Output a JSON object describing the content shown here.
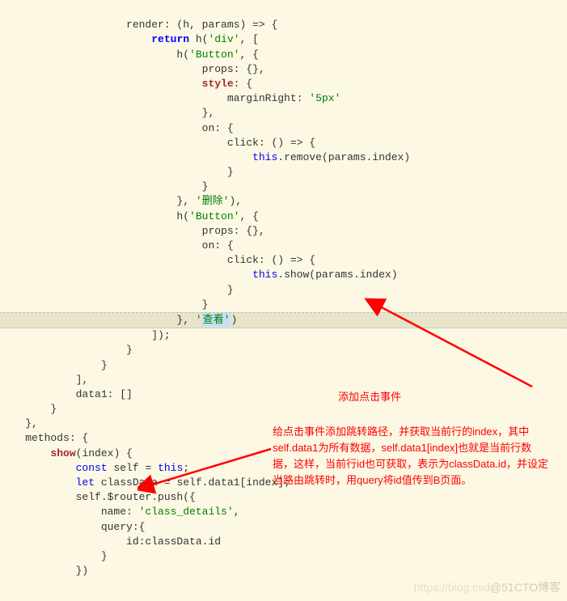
{
  "code": {
    "l1": "                    render: (h, params) => {",
    "l2a": "                        ",
    "l2b": "return",
    "l2c": " h(",
    "l2d": "'div'",
    "l2e": ", [",
    "l3a": "                            h(",
    "l3b": "'Button'",
    "l3c": ", {",
    "l4": "                                props: {},",
    "l5a": "                                ",
    "l5b": "style",
    "l5c": ": {",
    "l6a": "                                    marginRight: ",
    "l6b": "'5px'",
    "l7": "                                },",
    "l8": "                                on: {",
    "l9": "                                    click: () => {",
    "l10a": "                                        ",
    "l10b": "this",
    "l10c": ".remove(params.index)",
    "l11": "                                    }",
    "l12": "                                }",
    "l13a": "                            }, ",
    "l13b": "'删除'",
    "l13c": "),",
    "l14a": "                            h(",
    "l14b": "'Button'",
    "l14c": ", {",
    "l15": "                                props: {},",
    "l16": "                                on: {",
    "l17": "                                    click: () => {",
    "l18a": "                                        ",
    "l18b": "this",
    "l18c": ".show(params.index)",
    "l19": "                                    }",
    "l20": "                                }",
    "l21a": "                            }, ",
    "l21b": "'",
    "l21sel": "查看'",
    "l21c": ")",
    "l22": "                        ]);",
    "l23": "                    }",
    "l24": "                }",
    "l25": "            ],",
    "l26": "            data1: []",
    "l27": "        }",
    "l28": "    },",
    "l29": "    methods: {",
    "l30a": "        ",
    "l30b": "show",
    "l30c": "(index) {",
    "l31a": "            ",
    "l31b": "const",
    "l31c": " self = ",
    "l31d": "this",
    "l31e": ";",
    "l32a": "            ",
    "l32b": "let",
    "l32c": " classData = self.data1[index];",
    "l33": "            self.$router.push({",
    "l34a": "                name: ",
    "l34b": "'class_details'",
    "l34c": ",",
    "l35": "                query:{",
    "l36": "                    id:classData.id",
    "l37": "                }",
    "l38": "            })"
  },
  "annotations": {
    "a1": "添加点击事件",
    "a2": "给点击事件添加跳转路径，并获取当前行的index，其中self.data1为所有数据，self.data1[index]也就是当前行数据，这样，当前行id也可获取，表示为classData.id，并设定当路由跳转时，用query将id值传到B页面。"
  },
  "watermark": "@51CTO博客",
  "watermark_left": "https://blog.csd"
}
